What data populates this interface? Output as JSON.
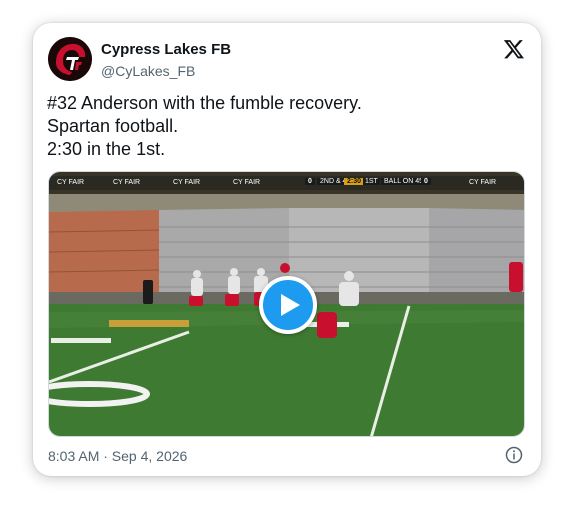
{
  "tweet": {
    "display_name": "Cypress Lakes FB",
    "handle": "@CyLakes_FB",
    "text_lines": [
      "#32 Anderson with the fumble recovery.",
      "Spartan football.",
      "2:30 in the 1st."
    ],
    "timestamp": "8:03 AM · Sep 4, 2026"
  },
  "video": {
    "banner_left": "CY FAIR",
    "score_home": "0",
    "down_distance": "2ND & 4",
    "clock": "2:30",
    "qtr": "1ST",
    "ball_on": "BALL ON 45",
    "score_away": "0"
  },
  "icons": {
    "brand": "x-logo-icon",
    "play": "play-icon",
    "info": "info-icon"
  },
  "colors": {
    "accent": "#1d9bf0",
    "text": "#0f1419",
    "muted": "#536471",
    "turf": "#3e7a32",
    "spartan_red": "#c8102e"
  }
}
